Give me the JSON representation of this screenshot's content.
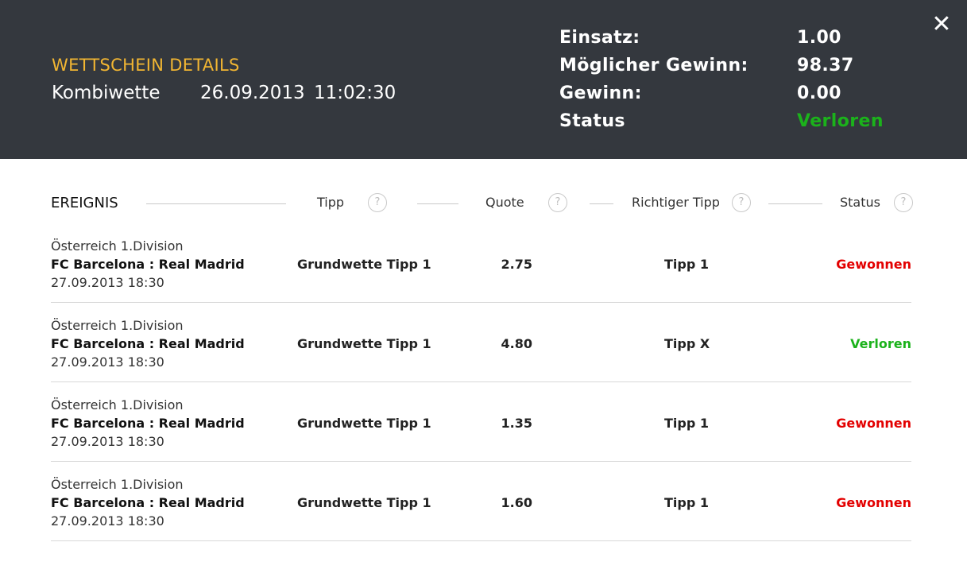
{
  "header": {
    "title": "WETTSCHEIN DETAILS",
    "bet_type": "Kombiwette",
    "date": "26.09.2013",
    "time": "11:02:30",
    "summary": {
      "stake_label": "Einsatz:",
      "stake_value": "1.00",
      "possible_win_label": "Möglicher Gewinn:",
      "possible_win_value": "98.37",
      "win_label": "Gewinn:",
      "win_value": "0.00",
      "status_label": "Status",
      "status_value": "Verloren"
    },
    "close_icon": "close-icon"
  },
  "columns": {
    "event": "EREIGNIS",
    "tip": "Tipp",
    "quote": "Quote",
    "correct_tip": "Richtiger Tipp",
    "status": "Status",
    "help_symbol": "?"
  },
  "rows": [
    {
      "league": "Österreich 1.Division",
      "match": "FC Barcelona : Real Madrid",
      "date": "27.09.2013 18:30",
      "tip": "Grundwette Tipp 1",
      "quote": "2.75",
      "correct_tip": "Tipp 1",
      "status": "Gewonnen"
    },
    {
      "league": "Österreich 1.Division",
      "match": "FC Barcelona : Real Madrid",
      "date": "27.09.2013 18:30",
      "tip": "Grundwette Tipp 1",
      "quote": "4.80",
      "correct_tip": "Tipp X",
      "status": "Verloren"
    },
    {
      "league": "Österreich 1.Division",
      "match": "FC Barcelona : Real Madrid",
      "date": "27.09.2013 18:30",
      "tip": "Grundwette Tipp 1",
      "quote": "1.35",
      "correct_tip": "Tipp 1",
      "status": "Gewonnen"
    },
    {
      "league": "Österreich 1.Division",
      "match": "FC Barcelona : Real Madrid",
      "date": "27.09.2013 18:30",
      "tip": "Grundwette Tipp 1",
      "quote": "1.60",
      "correct_tip": "Tipp 1",
      "status": "Gewonnen"
    }
  ],
  "colors": {
    "header_bg": "#34383e",
    "title_accent": "#f2b632",
    "status_won": "#e30000",
    "status_lost": "#1bb21b"
  }
}
